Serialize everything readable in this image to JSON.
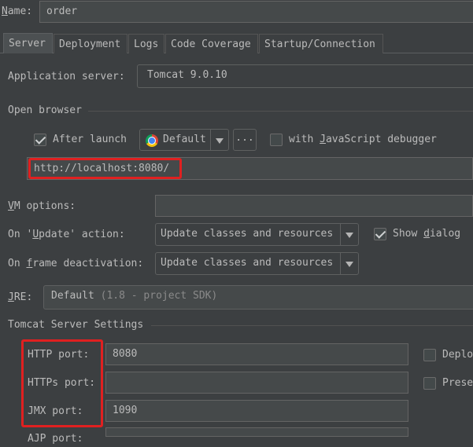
{
  "name": {
    "label": "Name:",
    "value": "order"
  },
  "tabs": [
    {
      "label": "Server",
      "active": true
    },
    {
      "label": "Deployment",
      "active": false
    },
    {
      "label": "Logs",
      "active": false
    },
    {
      "label": "Code Coverage",
      "active": false
    },
    {
      "label": "Startup/Connection",
      "active": false
    }
  ],
  "app_server": {
    "label": "Application server:",
    "value": "Tomcat 9.0.10"
  },
  "open_browser": {
    "section": "Open browser",
    "after_launch": {
      "label": "After launch",
      "checked": true
    },
    "browser": {
      "value": "Default",
      "icon": "chrome-icon"
    },
    "more_button": "...",
    "js_debugger": {
      "label_before": "with ",
      "label_mnemonic": "J",
      "label_after": "avaScript debugger",
      "checked": false
    },
    "url": "http://localhost:8080/"
  },
  "vm_options": {
    "label_mnemonic": "V",
    "label_after": "M options:",
    "value": ""
  },
  "on_update": {
    "label_before": "On '",
    "label_mnemonic": "U",
    "label_after": "pdate' action:",
    "value": "Update classes and resources",
    "show_dialog": {
      "label_before": "Show ",
      "label_mnemonic": "d",
      "label_after": "ialog",
      "checked": true
    }
  },
  "on_frame": {
    "label_before": "On ",
    "label_mnemonic": "f",
    "label_after": "rame deactivation:",
    "value": "Update classes and resources"
  },
  "jre": {
    "label_mnemonic": "J",
    "label_after": "RE:",
    "value": "Default",
    "hint": "(1.8 - project SDK)"
  },
  "tomcat": {
    "section": "Tomcat Server Settings",
    "http_port": {
      "label": "HTTP port:",
      "value": "8080"
    },
    "https_port": {
      "label": "HTTPs port:",
      "value": ""
    },
    "jmx_port": {
      "label": "JMX port:",
      "value": "1090"
    },
    "ajp_port": {
      "label": "AJP port:",
      "value": ""
    },
    "deploy": {
      "label": "Deplo",
      "checked": false
    },
    "preserve": {
      "label": "Prese",
      "checked": false
    }
  },
  "colors": {
    "background": "#3c3f41",
    "highlight_box": "#e02020",
    "field": "#45494a"
  }
}
